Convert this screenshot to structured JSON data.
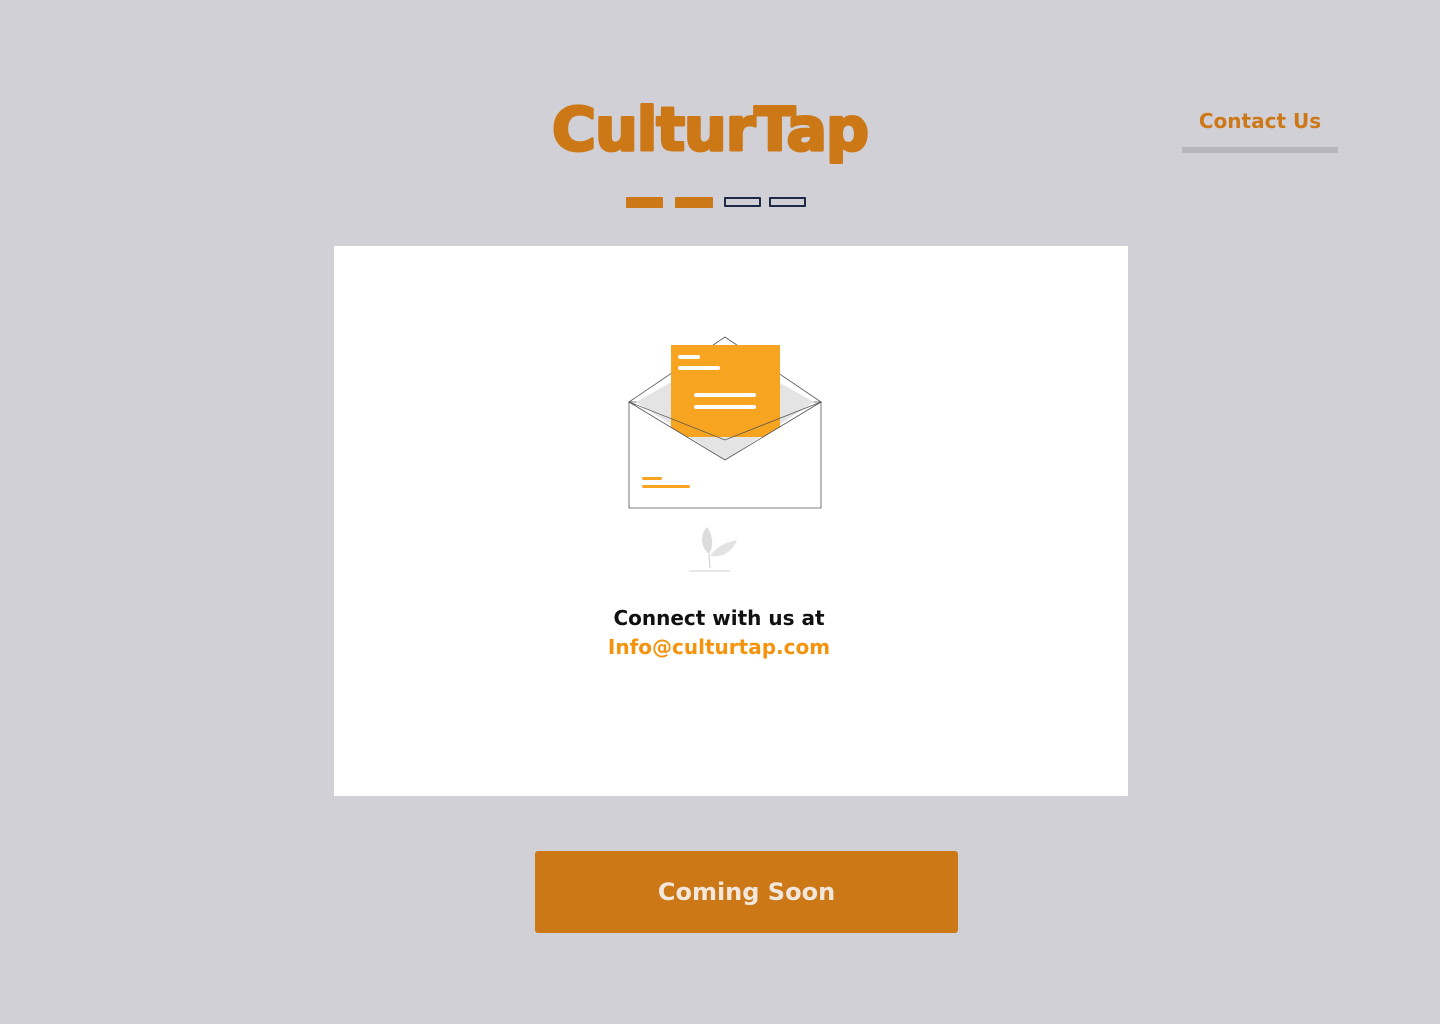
{
  "header": {
    "logo_text": "CulturTap",
    "nav_link_label": "Contact Us"
  },
  "progress": {
    "total_steps": 4,
    "completed_steps": 2
  },
  "card": {
    "illustration": "open-envelope-with-letter-icon",
    "connect_label": "Connect with us at",
    "email": "Info@culturtap.com"
  },
  "cta": {
    "label": "Coming Soon"
  },
  "colors": {
    "background": "#d1d0d6",
    "brand_orange": "#cd7817",
    "email_orange": "#f4940e",
    "letter_orange": "#f7a420",
    "card": "#ffffff",
    "step_outline": "#1d2a45"
  }
}
